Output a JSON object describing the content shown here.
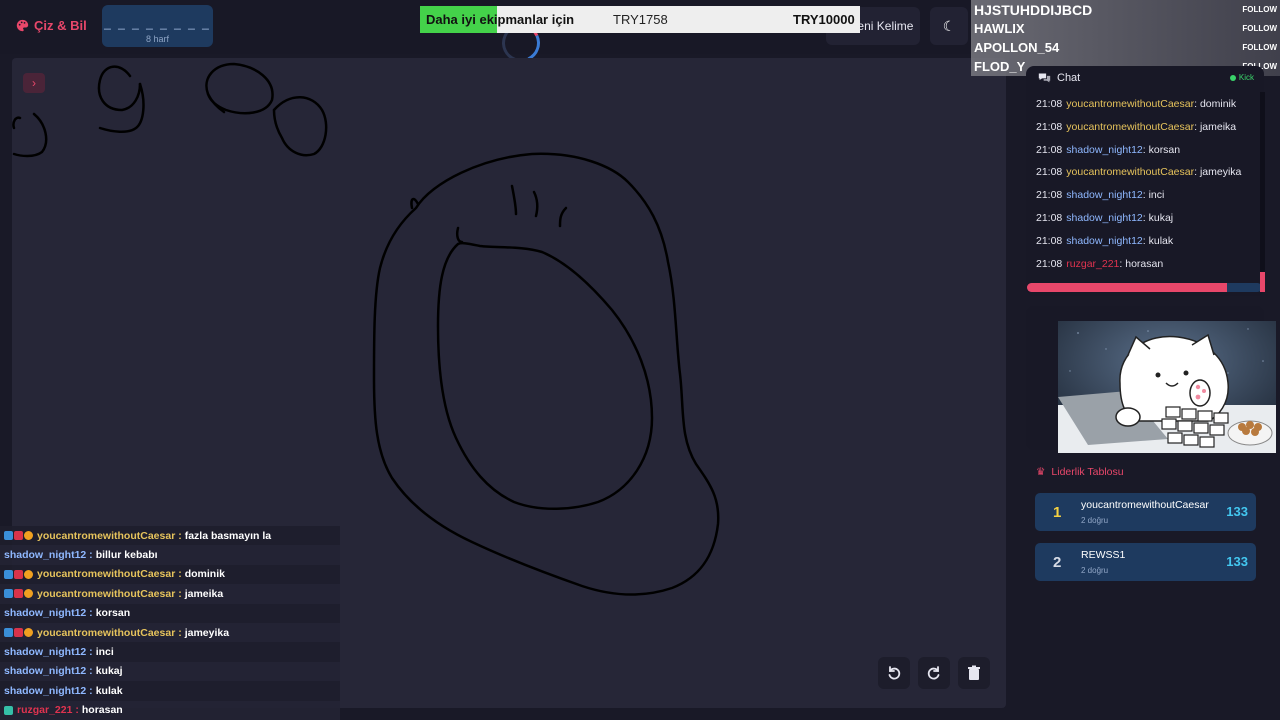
{
  "header": {
    "logo": "Çiz & Bil",
    "word_hint": "_ _ _ _ _ _ _ _",
    "letter_count": "8 harf",
    "new_word_label": "Yeni Kelime",
    "theme_icon": "moon-icon"
  },
  "donation": {
    "title": "Daha iyi ekipmanlar için",
    "current": "TRY1758",
    "goal": "TRY10000",
    "progress_fraction": 0.176
  },
  "follow_overlay": {
    "label": "FOLLOW",
    "names": [
      "HJSTUHDDIJBCD",
      "HAWLIX",
      "APOLLON_54",
      "FLOD_Y"
    ]
  },
  "stream_chat": [
    {
      "badges": true,
      "user": "youcantromewithoutCaesar",
      "color": "#e6c35c",
      "message": "fazla basmayın la"
    },
    {
      "badges": false,
      "user": "shadow_night12",
      "color": "#8fb8ff",
      "message": "billur kebabı"
    },
    {
      "badges": true,
      "user": "youcantromewithoutCaesar",
      "color": "#e6c35c",
      "message": "dominik"
    },
    {
      "badges": true,
      "user": "youcantromewithoutCaesar",
      "color": "#e6c35c",
      "message": "jameika"
    },
    {
      "badges": false,
      "user": "shadow_night12",
      "color": "#8fb8ff",
      "message": "korsan"
    },
    {
      "badges": true,
      "user": "youcantromewithoutCaesar",
      "color": "#e6c35c",
      "message": "jameyika"
    },
    {
      "badges": false,
      "user": "shadow_night12",
      "color": "#8fb8ff",
      "message": "inci"
    },
    {
      "badges": false,
      "user": "shadow_night12",
      "color": "#8fb8ff",
      "message": "kukaj"
    },
    {
      "badges": false,
      "user": "shadow_night12",
      "color": "#8fb8ff",
      "message": "kulak"
    },
    {
      "badges": false,
      "user": "ruzgar_221",
      "color": "#e0334f",
      "message": "horasan"
    }
  ],
  "chat_panel": {
    "title": "Chat",
    "source": "Kick",
    "messages": [
      {
        "time": "21:08",
        "user": "youcantromewithoutCaesar",
        "color": "#e6c35c",
        "text": "dominik"
      },
      {
        "time": "21:08",
        "user": "youcantromewithoutCaesar",
        "color": "#e6c35c",
        "text": "jameika"
      },
      {
        "time": "21:08",
        "user": "shadow_night12",
        "color": "#8fb8ff",
        "text": "korsan"
      },
      {
        "time": "21:08",
        "user": "youcantromewithoutCaesar",
        "color": "#e6c35c",
        "text": "jameyika"
      },
      {
        "time": "21:08",
        "user": "shadow_night12",
        "color": "#8fb8ff",
        "text": "inci"
      },
      {
        "time": "21:08",
        "user": "shadow_night12",
        "color": "#8fb8ff",
        "text": "kukaj"
      },
      {
        "time": "21:08",
        "user": "shadow_night12",
        "color": "#8fb8ff",
        "text": "kulak"
      },
      {
        "time": "21:08",
        "user": "ruzgar_221",
        "color": "#e0334f",
        "text": "horasan"
      }
    ],
    "timer_fraction": 0.85
  },
  "leaderboard": {
    "title": "Liderlik Tablosu",
    "entries": [
      {
        "rank": "1",
        "name": "youcantromewithoutCaesar",
        "sub": "2 doğru",
        "score": "133",
        "rank_color": "#f5d142"
      },
      {
        "rank": "2",
        "name": "REWSS1",
        "sub": "2 doğru",
        "score": "133",
        "rank_color": "#d6dbe6"
      }
    ]
  },
  "colors": {
    "accent": "#e8476a",
    "panel": "#1e3a5f",
    "canvas": "#262637"
  }
}
